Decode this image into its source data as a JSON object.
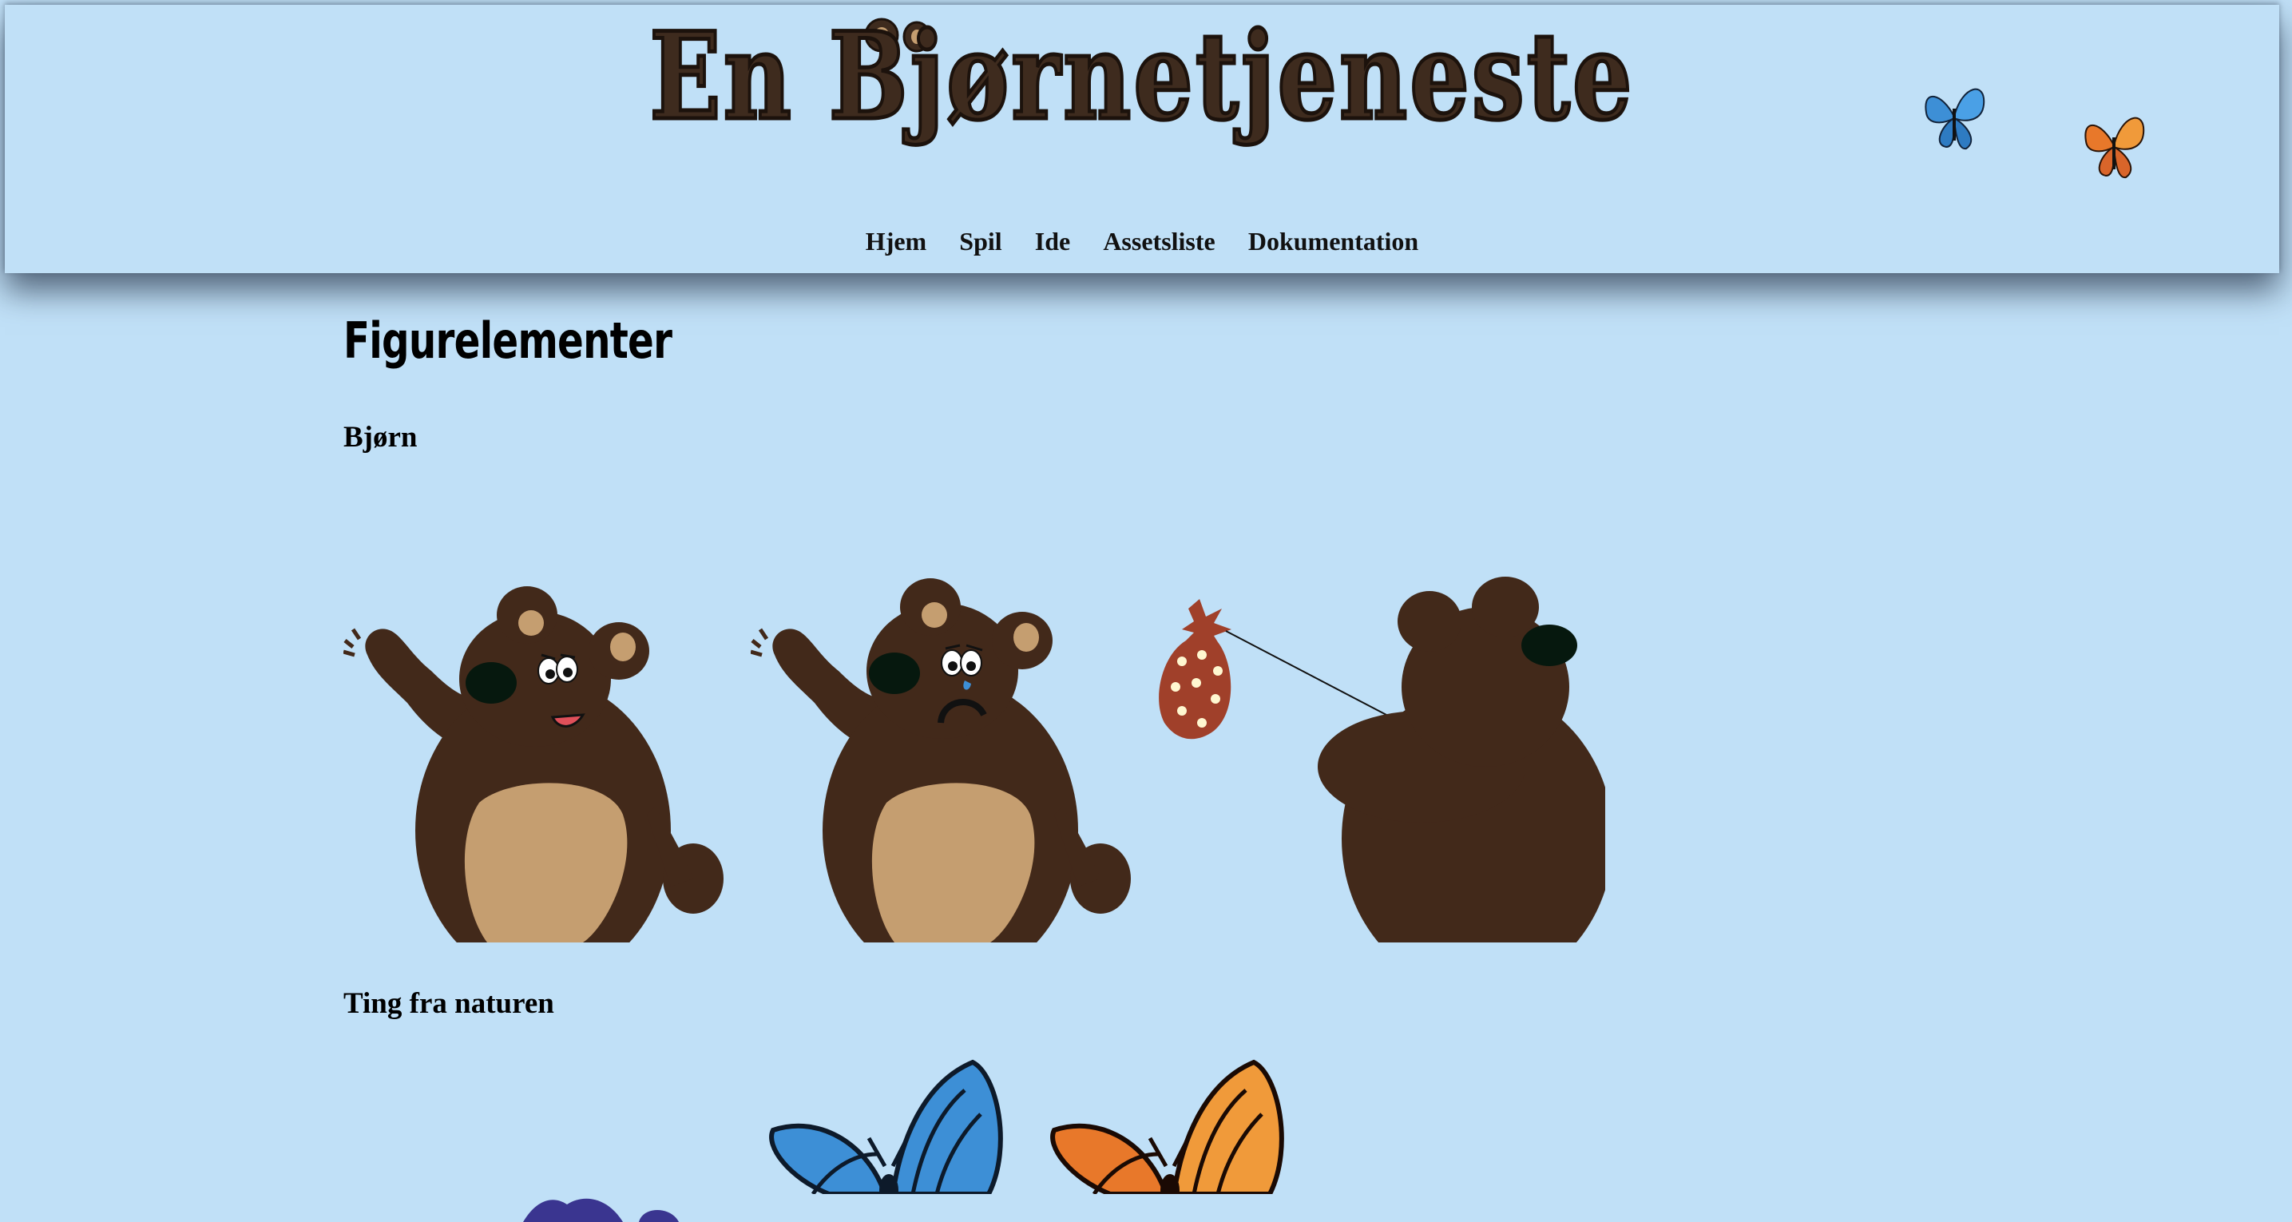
{
  "header": {
    "site_title": "En Bjørnetjeneste",
    "nav": [
      {
        "label": "Hjem"
      },
      {
        "label": "Spil"
      },
      {
        "label": "Ide"
      },
      {
        "label": "Assetsliste"
      },
      {
        "label": "Dokumentation"
      }
    ]
  },
  "main": {
    "page_heading": "Figurelementer",
    "sections": [
      {
        "heading": "Bjørn"
      },
      {
        "heading": "Ting fra naturen"
      }
    ]
  },
  "colors": {
    "background": "#c0e0f7",
    "bear_fur": "#42291a",
    "bear_belly": "#c59e70",
    "title_text": "#3e2b1e",
    "hive_red": "#a0402a",
    "butterfly_blue": "#3d8fd6",
    "butterfly_orange": "#e8782a"
  }
}
